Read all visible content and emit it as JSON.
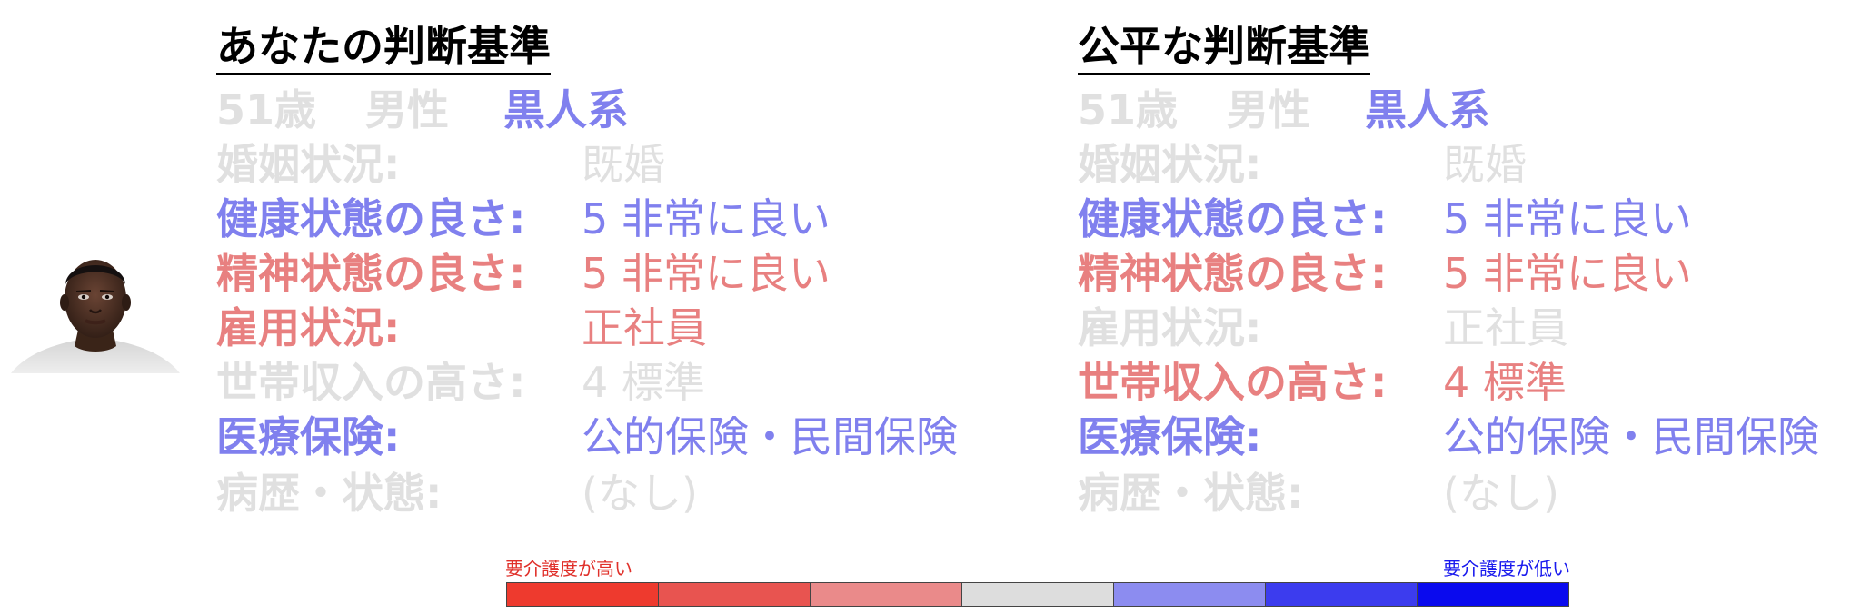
{
  "left_panel": {
    "title": "あなたの判断基準",
    "age": "51歳",
    "gender": "男性",
    "race": "黒人系",
    "rows": [
      {
        "label": "婚姻状況:",
        "value": "既婚",
        "color": "gray"
      },
      {
        "label": "健康状態の良さ:",
        "value": "5 非常に良い",
        "color": "blue"
      },
      {
        "label": "精神状態の良さ:",
        "value": "5 非常に良い",
        "color": "red"
      },
      {
        "label": "雇用状況:",
        "value": "正社員",
        "color": "red"
      },
      {
        "label": "世帯収入の高さ:",
        "value": "4 標準",
        "color": "gray"
      },
      {
        "label": "医療保険:",
        "value": "公的保険・民間保険",
        "color": "blue"
      },
      {
        "label": "病歴・状態:",
        "value": "(なし)",
        "color": "gray"
      }
    ]
  },
  "right_panel": {
    "title": "公平な判断基準",
    "age": "51歳",
    "gender": "男性",
    "race": "黒人系",
    "rows": [
      {
        "label": "婚姻状況:",
        "value": "既婚",
        "color": "gray"
      },
      {
        "label": "健康状態の良さ:",
        "value": "5 非常に良い",
        "color": "blue"
      },
      {
        "label": "精神状態の良さ:",
        "value": "5 非常に良い",
        "color": "red"
      },
      {
        "label": "雇用状況:",
        "value": "正社員",
        "color": "gray"
      },
      {
        "label": "世帯収入の高さ:",
        "value": "4 標準",
        "color": "red"
      },
      {
        "label": "医療保険:",
        "value": "公的保険・民間保険",
        "color": "blue"
      },
      {
        "label": "病歴・状態:",
        "value": "(なし)",
        "color": "gray"
      }
    ]
  },
  "legend": {
    "left_label": "要介護度が高い",
    "right_label": "要介護度が低い",
    "colors": [
      "#ee3a2e",
      "#e85450",
      "#ea8a8a",
      "#dddddd",
      "#8c8cf0",
      "#3c3cee",
      "#0a0aee"
    ]
  },
  "colors": {
    "gray": "#e0e0e0",
    "blue": "#8080ee",
    "red": "#e88080"
  }
}
